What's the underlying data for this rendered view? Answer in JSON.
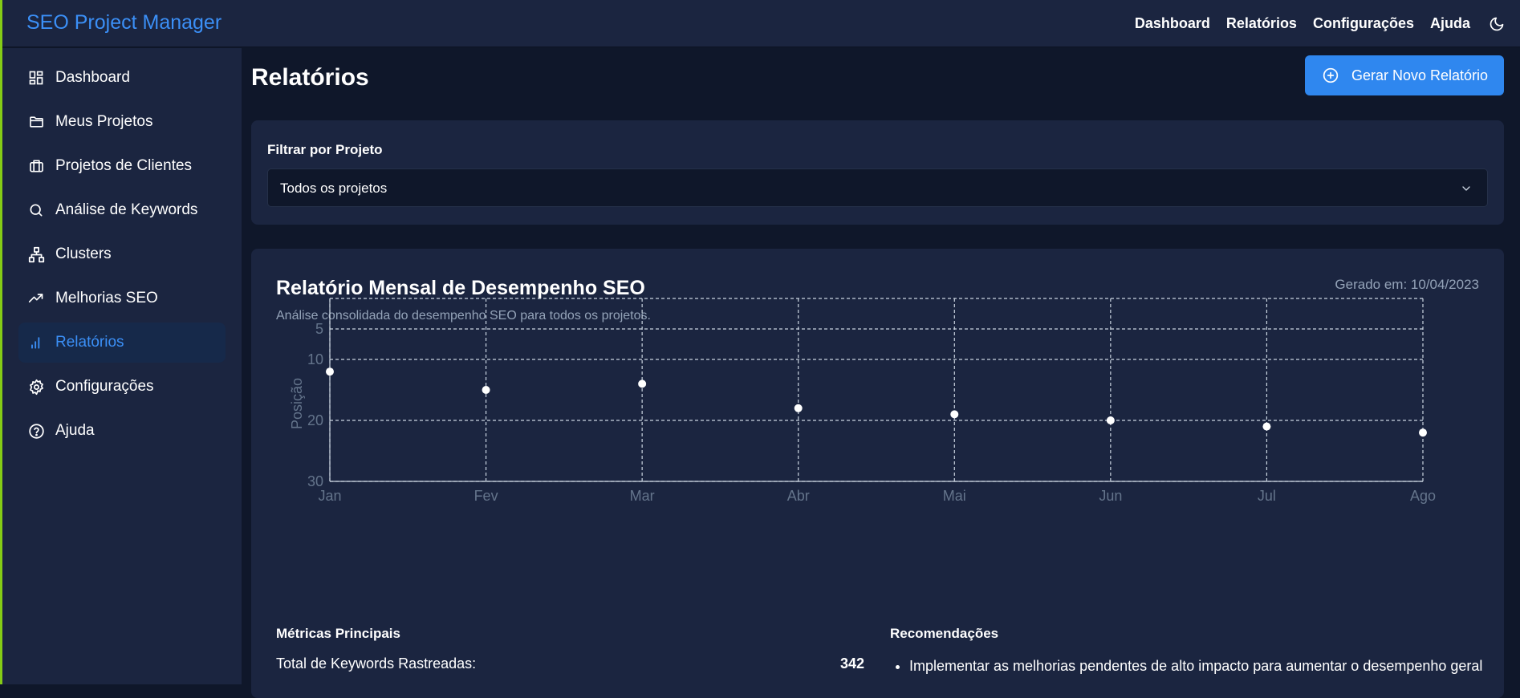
{
  "app": {
    "title": "SEO Project Manager"
  },
  "topnav": {
    "items": [
      {
        "label": "Dashboard"
      },
      {
        "label": "Relatórios"
      },
      {
        "label": "Configurações"
      },
      {
        "label": "Ajuda"
      }
    ],
    "theme_icon": "moon-icon"
  },
  "sidebar": {
    "items": [
      {
        "label": "Dashboard",
        "icon": "dashboard-icon"
      },
      {
        "label": "Meus Projetos",
        "icon": "folder-icon"
      },
      {
        "label": "Projetos de Clientes",
        "icon": "briefcase-icon"
      },
      {
        "label": "Análise de Keywords",
        "icon": "search-icon"
      },
      {
        "label": "Clusters",
        "icon": "network-icon"
      },
      {
        "label": "Melhorias SEO",
        "icon": "trending-up-icon"
      },
      {
        "label": "Relatórios",
        "icon": "bar-chart-icon",
        "active": true
      },
      {
        "label": "Configurações",
        "icon": "gear-icon"
      },
      {
        "label": "Ajuda",
        "icon": "help-circle-icon"
      }
    ]
  },
  "page": {
    "title": "Relatórios",
    "new_report_button": "Gerar Novo Relatório"
  },
  "filter": {
    "label": "Filtrar por Projeto",
    "selected": "Todos os projetos"
  },
  "report": {
    "title": "Relatório Mensal de Desempenho SEO",
    "subtitle": "Análise consolidada do desempenho SEO para todos os projetos.",
    "generated": "Gerado em: 10/04/2023",
    "metrics_title": "Métricas Principais",
    "metrics": [
      {
        "label": "Total de Keywords Rastreadas:",
        "value": "342"
      }
    ],
    "recommendations_title": "Recomendações",
    "recommendations": [
      "Implementar as melhorias pendentes de alto impacto para aumentar o desempenho geral"
    ]
  },
  "colors": {
    "accent": "#2f87ef",
    "brand": "#3b8ff6",
    "background": "#0f172a",
    "panel": "#1b2540"
  },
  "chart_data": {
    "type": "scatter",
    "categories": [
      "Jan",
      "Fev",
      "Mar",
      "Abr",
      "Mai",
      "Jun",
      "Jul",
      "Ago"
    ],
    "values": [
      12,
      15,
      14,
      18,
      19,
      20,
      21,
      22
    ],
    "ylabel": "Posição",
    "yticks": [
      5,
      10,
      20,
      30
    ],
    "ylim": [
      0,
      30
    ],
    "y_reversed": true,
    "grid": true
  }
}
